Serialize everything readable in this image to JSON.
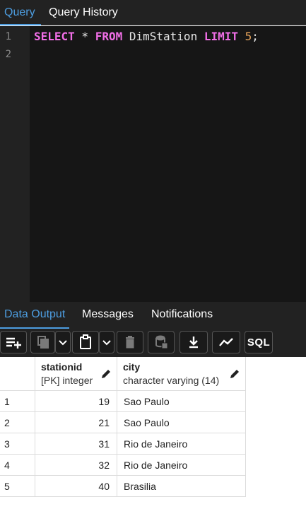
{
  "tabs": {
    "query": "Query",
    "history": "Query History"
  },
  "editor": {
    "line_numbers": [
      "1",
      "2"
    ],
    "sql": {
      "select": "SELECT",
      "star": " * ",
      "from": "FROM",
      "table": " DimStation ",
      "limit": "LIMIT",
      "space": " ",
      "limit_value": "5",
      "semicolon": ";"
    }
  },
  "output_tabs": {
    "data_output": "Data Output",
    "messages": "Messages",
    "notifications": "Notifications"
  },
  "toolbar": {
    "icons": [
      "add-row-icon",
      "copy-icon",
      "chevron-down-icon",
      "paste-icon",
      "chevron-down-icon",
      "delete-icon",
      "save-data-icon",
      "download-icon",
      "graph-icon",
      "sql-icon"
    ],
    "sql_label": "SQL"
  },
  "columns": [
    {
      "name": "stationid",
      "type": "[PK] integer"
    },
    {
      "name": "city",
      "type": "character varying (14)"
    }
  ],
  "rows": [
    {
      "rownum": "1",
      "stationid": "19",
      "city": "Sao Paulo"
    },
    {
      "rownum": "2",
      "stationid": "21",
      "city": "Sao Paulo"
    },
    {
      "rownum": "3",
      "stationid": "31",
      "city": "Rio de Janeiro"
    },
    {
      "rownum": "4",
      "stationid": "32",
      "city": "Rio de Janeiro"
    },
    {
      "rownum": "5",
      "stationid": "40",
      "city": "Brasilia"
    }
  ],
  "colors": {
    "accent": "#4d9de0",
    "keyword": "#f26fe8",
    "number": "#e5a35a",
    "editor_bg": "#161616",
    "panel_bg": "#222222"
  }
}
